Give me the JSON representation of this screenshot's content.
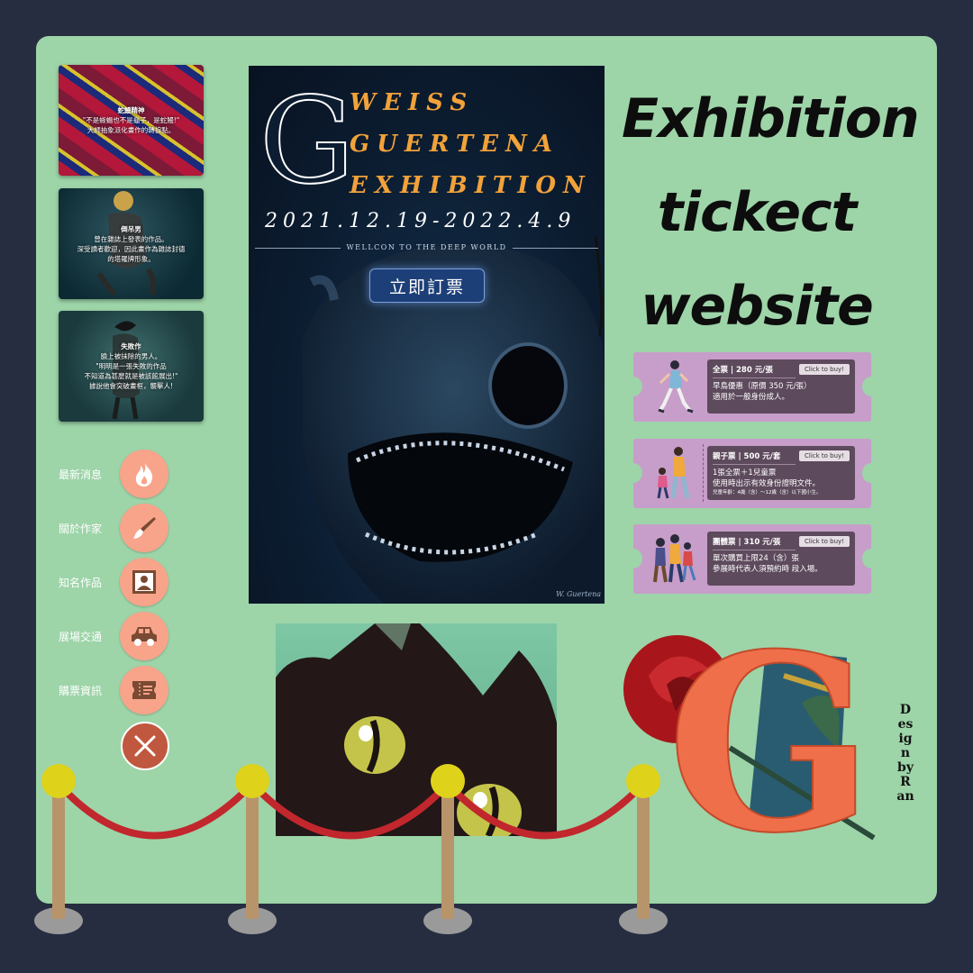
{
  "colors": {
    "background": "#272d41",
    "board": "#9dd4a8",
    "nav_circle": "#f7a48b",
    "close_circle": "#c0583f",
    "ticket": "#c79ec9",
    "ticket_info": "#5d4a5c",
    "poster_title": "#f2a23a"
  },
  "gallery": [
    {
      "title": "蛇鰻精神",
      "lines": [
        "\"不是蜥蜴也不是龜子，是蛇鰻!\"",
        "大師抽象派化畫作的轉捩點。"
      ]
    },
    {
      "title": "倒吊男",
      "lines": [
        "曾在雜誌上發表的作品。",
        "深受讀者歡迎，因此畫作為雜誌封德",
        "的塔羅牌形象。"
      ]
    },
    {
      "title": "失敗作",
      "lines": [
        "臉上被抹除的男人。",
        "\"明明是一張失敗的作品",
        "不知道為甚麼就是被該館展出!\"",
        "據說他會突破畫框，襲擊人!"
      ]
    }
  ],
  "nav": {
    "items": [
      {
        "label": "最新消息",
        "icon": "flame-icon"
      },
      {
        "label": "關於作家",
        "icon": "brush-icon"
      },
      {
        "label": "知名作品",
        "icon": "picture-icon"
      },
      {
        "label": "展場交通",
        "icon": "car-icon"
      },
      {
        "label": "購票資訊",
        "icon": "ticket-icon"
      }
    ],
    "close_icon": "close-icon"
  },
  "poster": {
    "letter": "G",
    "title_lines": [
      "WEISS",
      "GUERTENA",
      "EXHIBITION"
    ],
    "dates": "2021.12.19-2022.4.9",
    "tagline": "WELLCON TO THE DEEP WORLD",
    "buy_label": "立即訂票",
    "signature": "W. Guertena"
  },
  "heading": {
    "lines": [
      "Exhibition",
      "tickect",
      "website"
    ]
  },
  "tickets": [
    {
      "title": "全票 | 280 元/張",
      "click": "Click to buy!",
      "lines": [
        "早鳥優惠（原價 350 元/張）",
        "適用於一般身份成人。"
      ],
      "note": ""
    },
    {
      "title": "親子票 | 500 元/套",
      "click": "Click to buy!",
      "lines": [
        "1張全票＋1兒童票",
        "使用時出示有效身份證明文件。"
      ],
      "note": "兒童年齡：4歲（含）～12歲（含）以下國小生。"
    },
    {
      "title": "團體票 | 310 元/張",
      "click": "Click to buy!",
      "lines": [
        "單次購買上限24（含）張",
        "參展時代表人須預約時 段入場。"
      ],
      "note": ""
    }
  ],
  "logo": {
    "letter": "G"
  },
  "credit": "Design by Ran"
}
